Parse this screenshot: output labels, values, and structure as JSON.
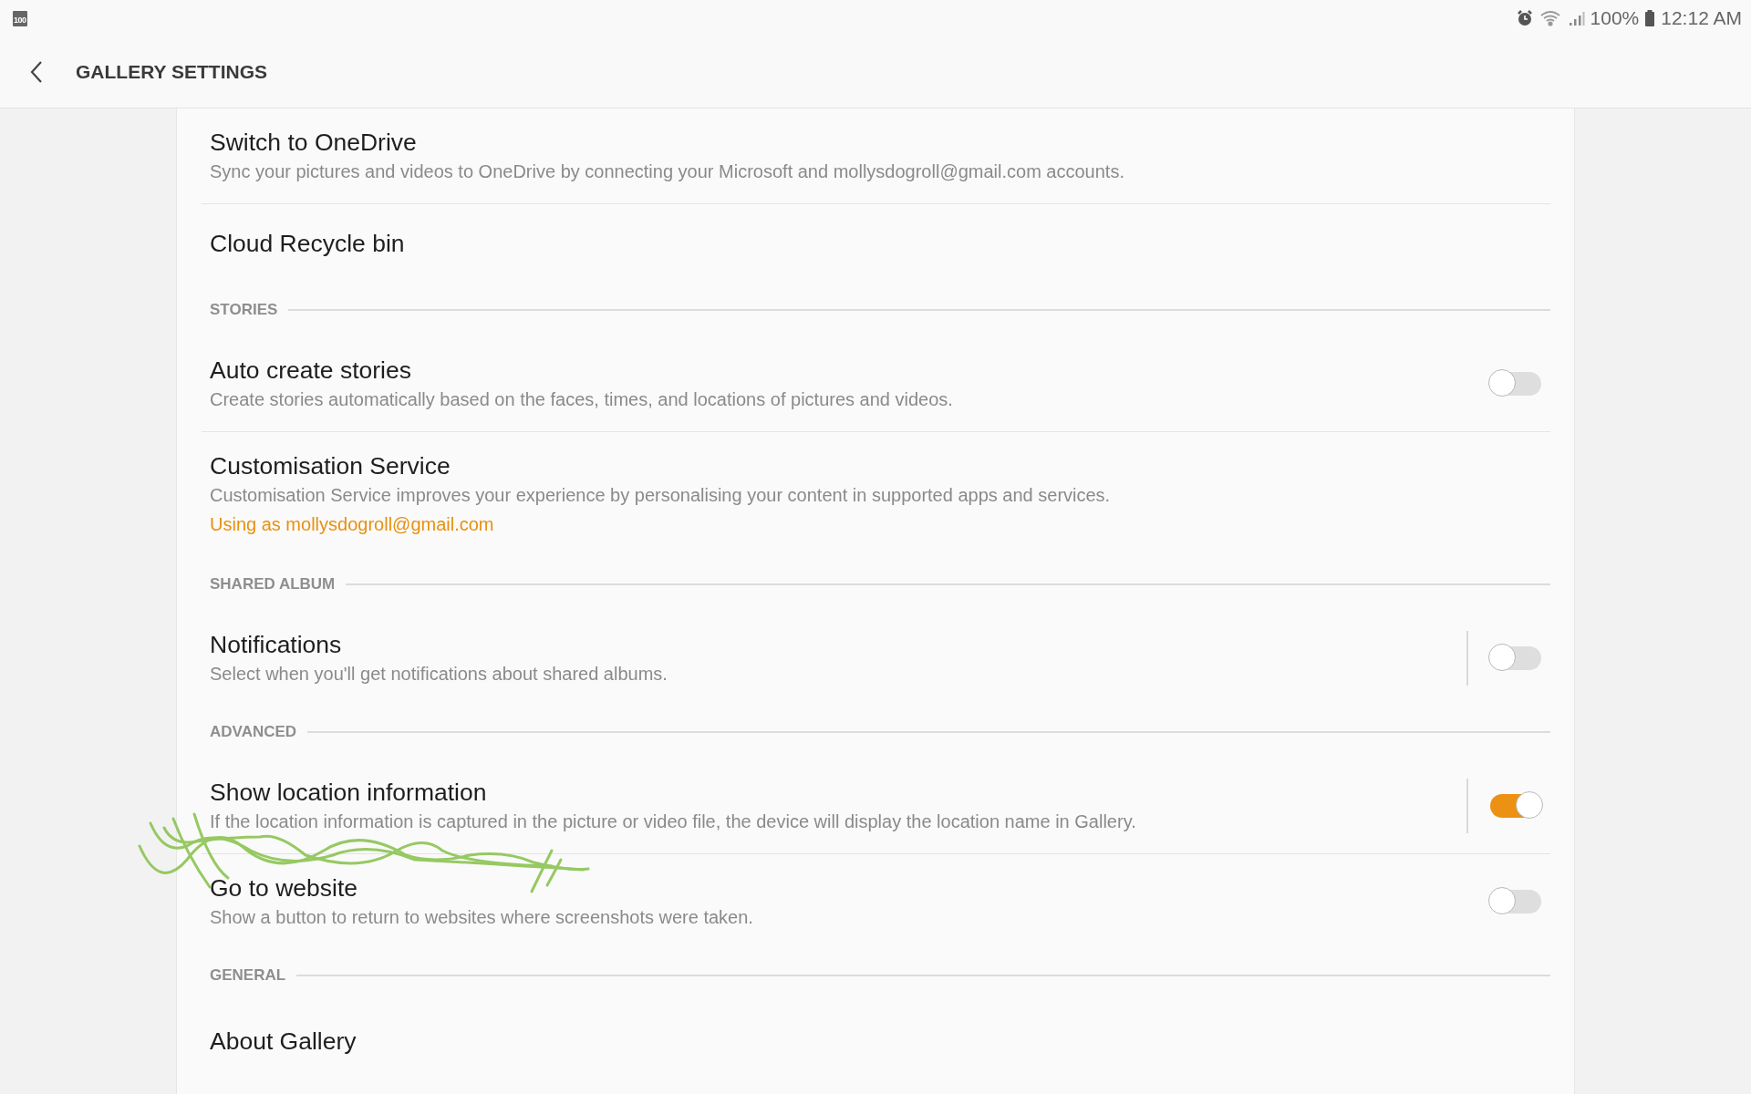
{
  "status_bar": {
    "badge": "100",
    "battery": "100%",
    "time": "12:12 AM"
  },
  "header": {
    "title": "GALLERY SETTINGS"
  },
  "sections": [
    {
      "items": [
        {
          "title": "Switch to OneDrive",
          "subtitle": "Sync your pictures and videos to OneDrive by connecting your Microsoft and mollysdogroll@gmail.com accounts."
        },
        {
          "title": "Cloud Recycle bin"
        }
      ]
    },
    {
      "header": "STORIES",
      "items": [
        {
          "title": "Auto create stories",
          "subtitle": "Create stories automatically based on the faces, times, and locations of pictures and videos.",
          "toggle": {
            "on": false,
            "divider": false
          }
        },
        {
          "title": "Customisation Service",
          "subtitle": "Customisation Service improves your experience by personalising your content in supported apps and services.",
          "link": "Using as mollysdogroll@gmail.com"
        }
      ]
    },
    {
      "header": "SHARED ALBUM",
      "items": [
        {
          "title": "Notifications",
          "subtitle": "Select when you'll get notifications about shared albums.",
          "toggle": {
            "on": false,
            "divider": true
          }
        }
      ]
    },
    {
      "header": "ADVANCED",
      "items": [
        {
          "title": "Show location information",
          "subtitle": "If the location information is captured in the picture or video file, the device will display the location name in Gallery.",
          "toggle": {
            "on": true,
            "divider": true
          }
        },
        {
          "title": "Go to website",
          "subtitle": "Show a button to return to websites where screenshots were taken.",
          "toggle": {
            "on": false,
            "divider": false
          }
        }
      ]
    },
    {
      "header": "GENERAL",
      "items": [
        {
          "title": "About Gallery"
        }
      ]
    }
  ]
}
